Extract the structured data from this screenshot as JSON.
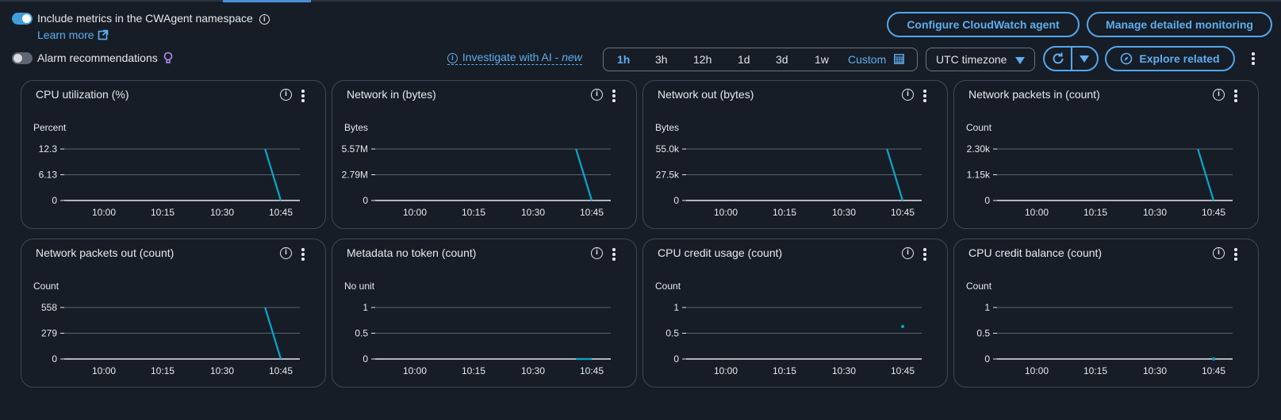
{
  "header": {
    "cwagent_toggle": {
      "label": "Include metrics in the CWAgent namespace",
      "on": true
    },
    "learn_more": "Learn more",
    "alarm_toggle": {
      "label": "Alarm recommendations",
      "on": false
    },
    "investigate": {
      "label": "Investigate with AI - ",
      "badge": "new"
    },
    "configure_button": "Configure CloudWatch agent",
    "manage_button": "Manage detailed monitoring",
    "time_ranges": [
      {
        "label": "1h",
        "active": true
      },
      {
        "label": "3h",
        "active": false
      },
      {
        "label": "12h",
        "active": false
      },
      {
        "label": "1d",
        "active": false
      },
      {
        "label": "3d",
        "active": false
      },
      {
        "label": "1w",
        "active": false
      }
    ],
    "custom_range": "Custom",
    "timezone": "UTC timezone",
    "explore_button": "Explore related"
  },
  "x_ticks": [
    "10:00",
    "10:15",
    "10:30",
    "10:45"
  ],
  "colors": {
    "accent": "#5eaef0",
    "series": "#0aa6c9",
    "grid": "#5a6470"
  },
  "chart_data": [
    {
      "type": "line",
      "title": "CPU utilization (%)",
      "unit": "Percent",
      "yticks": [
        "12.3",
        "6.13",
        "0"
      ],
      "ylim": [
        0,
        12.3
      ],
      "x": [
        "10:41",
        "10:45"
      ],
      "y": [
        12.3,
        0
      ],
      "style": "line"
    },
    {
      "type": "line",
      "title": "Network in (bytes)",
      "unit": "Bytes",
      "yticks": [
        "5.57M",
        "2.79M",
        "0"
      ],
      "ylim": [
        0,
        5570000
      ],
      "x": [
        "10:41",
        "10:45"
      ],
      "y": [
        5570000,
        0
      ],
      "style": "line"
    },
    {
      "type": "line",
      "title": "Network out (bytes)",
      "unit": "Bytes",
      "yticks": [
        "55.0k",
        "27.5k",
        "0"
      ],
      "ylim": [
        0,
        55000
      ],
      "x": [
        "10:41",
        "10:45"
      ],
      "y": [
        55000,
        0
      ],
      "style": "line"
    },
    {
      "type": "line",
      "title": "Network packets in (count)",
      "unit": "Count",
      "yticks": [
        "2.30k",
        "1.15k",
        "0"
      ],
      "ylim": [
        0,
        2300
      ],
      "x": [
        "10:41",
        "10:45"
      ],
      "y": [
        2300,
        0
      ],
      "style": "line"
    },
    {
      "type": "line",
      "title": "Network packets out (count)",
      "unit": "Count",
      "yticks": [
        "558",
        "279",
        "0"
      ],
      "ylim": [
        0,
        558
      ],
      "x": [
        "10:41",
        "10:45"
      ],
      "y": [
        558,
        0
      ],
      "style": "line"
    },
    {
      "type": "line",
      "title": "Metadata no token (count)",
      "unit": "No unit",
      "yticks": [
        "1",
        "0.5",
        "0"
      ],
      "ylim": [
        0,
        1
      ],
      "x": [
        "10:41",
        "10:45"
      ],
      "y": [
        0,
        0
      ],
      "style": "line"
    },
    {
      "type": "scatter",
      "title": "CPU credit usage (count)",
      "unit": "Count",
      "yticks": [
        "1",
        "0.5",
        "0"
      ],
      "ylim": [
        0,
        1
      ],
      "x": [
        "10:45"
      ],
      "y": [
        0.63
      ],
      "style": "point"
    },
    {
      "type": "scatter",
      "title": "CPU credit balance (count)",
      "unit": "Count",
      "yticks": [
        "1",
        "0.5",
        "0"
      ],
      "ylim": [
        0,
        1
      ],
      "x": [
        "10:45"
      ],
      "y": [
        0
      ],
      "style": "point"
    }
  ]
}
